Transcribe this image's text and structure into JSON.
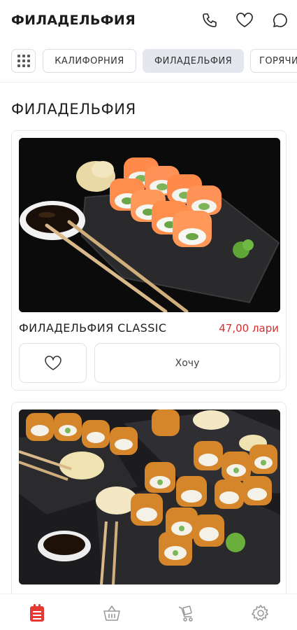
{
  "header": {
    "title": "ФИЛАДЕЛЬФИЯ",
    "icons": [
      "phone-icon",
      "heart-icon",
      "chat-icon"
    ]
  },
  "categories": {
    "items": [
      {
        "label": "КАЛИФОРНИЯ",
        "active": false
      },
      {
        "label": "ФИЛАДЕЛЬФИЯ",
        "active": true
      },
      {
        "label": "ГОРЯЧИ",
        "active": false
      }
    ]
  },
  "section": {
    "title": "ФИЛАДЕЛЬФИЯ"
  },
  "products": [
    {
      "name": "ФИЛАДЕЛЬФИЯ CLASSIC",
      "price": "47,00 лари",
      "want_label": "Хочу"
    },
    {
      "name": "",
      "price": "",
      "want_label": ""
    }
  ],
  "bottom_nav": {
    "items": [
      "menu-icon",
      "basket-icon",
      "delivery-cart-icon",
      "settings-icon"
    ],
    "active_color": "#e53935",
    "inactive_color": "#9a9a9a"
  },
  "colors": {
    "price": "#d32f2f",
    "active_chip": "#e4e7ee"
  }
}
